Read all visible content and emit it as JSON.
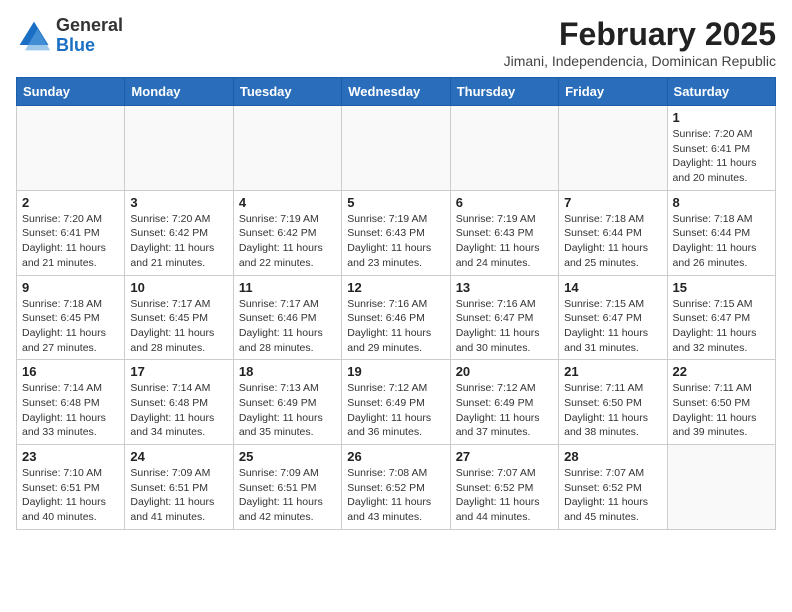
{
  "logo": {
    "general": "General",
    "blue": "Blue"
  },
  "title": "February 2025",
  "subtitle": "Jimani, Independencia, Dominican Republic",
  "days_of_week": [
    "Sunday",
    "Monday",
    "Tuesday",
    "Wednesday",
    "Thursday",
    "Friday",
    "Saturday"
  ],
  "weeks": [
    [
      {
        "day": "",
        "info": ""
      },
      {
        "day": "",
        "info": ""
      },
      {
        "day": "",
        "info": ""
      },
      {
        "day": "",
        "info": ""
      },
      {
        "day": "",
        "info": ""
      },
      {
        "day": "",
        "info": ""
      },
      {
        "day": "1",
        "info": "Sunrise: 7:20 AM\nSunset: 6:41 PM\nDaylight: 11 hours\nand 20 minutes."
      }
    ],
    [
      {
        "day": "2",
        "info": "Sunrise: 7:20 AM\nSunset: 6:41 PM\nDaylight: 11 hours\nand 21 minutes."
      },
      {
        "day": "3",
        "info": "Sunrise: 7:20 AM\nSunset: 6:42 PM\nDaylight: 11 hours\nand 21 minutes."
      },
      {
        "day": "4",
        "info": "Sunrise: 7:19 AM\nSunset: 6:42 PM\nDaylight: 11 hours\nand 22 minutes."
      },
      {
        "day": "5",
        "info": "Sunrise: 7:19 AM\nSunset: 6:43 PM\nDaylight: 11 hours\nand 23 minutes."
      },
      {
        "day": "6",
        "info": "Sunrise: 7:19 AM\nSunset: 6:43 PM\nDaylight: 11 hours\nand 24 minutes."
      },
      {
        "day": "7",
        "info": "Sunrise: 7:18 AM\nSunset: 6:44 PM\nDaylight: 11 hours\nand 25 minutes."
      },
      {
        "day": "8",
        "info": "Sunrise: 7:18 AM\nSunset: 6:44 PM\nDaylight: 11 hours\nand 26 minutes."
      }
    ],
    [
      {
        "day": "9",
        "info": "Sunrise: 7:18 AM\nSunset: 6:45 PM\nDaylight: 11 hours\nand 27 minutes."
      },
      {
        "day": "10",
        "info": "Sunrise: 7:17 AM\nSunset: 6:45 PM\nDaylight: 11 hours\nand 28 minutes."
      },
      {
        "day": "11",
        "info": "Sunrise: 7:17 AM\nSunset: 6:46 PM\nDaylight: 11 hours\nand 28 minutes."
      },
      {
        "day": "12",
        "info": "Sunrise: 7:16 AM\nSunset: 6:46 PM\nDaylight: 11 hours\nand 29 minutes."
      },
      {
        "day": "13",
        "info": "Sunrise: 7:16 AM\nSunset: 6:47 PM\nDaylight: 11 hours\nand 30 minutes."
      },
      {
        "day": "14",
        "info": "Sunrise: 7:15 AM\nSunset: 6:47 PM\nDaylight: 11 hours\nand 31 minutes."
      },
      {
        "day": "15",
        "info": "Sunrise: 7:15 AM\nSunset: 6:47 PM\nDaylight: 11 hours\nand 32 minutes."
      }
    ],
    [
      {
        "day": "16",
        "info": "Sunrise: 7:14 AM\nSunset: 6:48 PM\nDaylight: 11 hours\nand 33 minutes."
      },
      {
        "day": "17",
        "info": "Sunrise: 7:14 AM\nSunset: 6:48 PM\nDaylight: 11 hours\nand 34 minutes."
      },
      {
        "day": "18",
        "info": "Sunrise: 7:13 AM\nSunset: 6:49 PM\nDaylight: 11 hours\nand 35 minutes."
      },
      {
        "day": "19",
        "info": "Sunrise: 7:12 AM\nSunset: 6:49 PM\nDaylight: 11 hours\nand 36 minutes."
      },
      {
        "day": "20",
        "info": "Sunrise: 7:12 AM\nSunset: 6:49 PM\nDaylight: 11 hours\nand 37 minutes."
      },
      {
        "day": "21",
        "info": "Sunrise: 7:11 AM\nSunset: 6:50 PM\nDaylight: 11 hours\nand 38 minutes."
      },
      {
        "day": "22",
        "info": "Sunrise: 7:11 AM\nSunset: 6:50 PM\nDaylight: 11 hours\nand 39 minutes."
      }
    ],
    [
      {
        "day": "23",
        "info": "Sunrise: 7:10 AM\nSunset: 6:51 PM\nDaylight: 11 hours\nand 40 minutes."
      },
      {
        "day": "24",
        "info": "Sunrise: 7:09 AM\nSunset: 6:51 PM\nDaylight: 11 hours\nand 41 minutes."
      },
      {
        "day": "25",
        "info": "Sunrise: 7:09 AM\nSunset: 6:51 PM\nDaylight: 11 hours\nand 42 minutes."
      },
      {
        "day": "26",
        "info": "Sunrise: 7:08 AM\nSunset: 6:52 PM\nDaylight: 11 hours\nand 43 minutes."
      },
      {
        "day": "27",
        "info": "Sunrise: 7:07 AM\nSunset: 6:52 PM\nDaylight: 11 hours\nand 44 minutes."
      },
      {
        "day": "28",
        "info": "Sunrise: 7:07 AM\nSunset: 6:52 PM\nDaylight: 11 hours\nand 45 minutes."
      },
      {
        "day": "",
        "info": ""
      }
    ]
  ]
}
